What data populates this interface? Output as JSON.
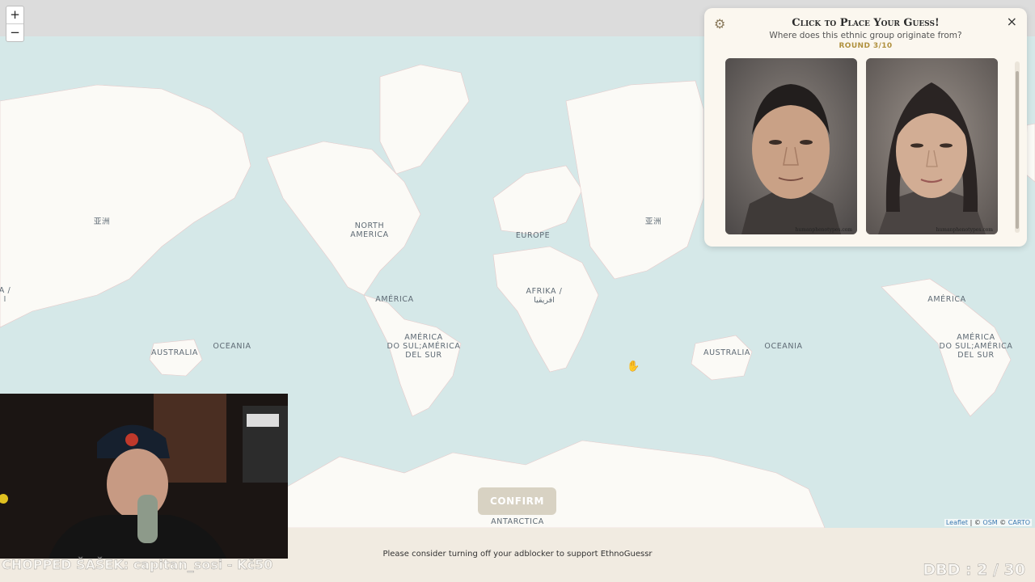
{
  "app": {
    "name": "EthnoGuessr"
  },
  "zoom": {
    "in_label": "+",
    "out_label": "−"
  },
  "panel": {
    "title": "Click to Place Your Guess!",
    "subtitle": "Where does this ethnic group originate from?",
    "round": "ROUND 3/10",
    "photo_credit": "humanphenotypes.com",
    "photos": [
      "male composite face",
      "female composite face"
    ],
    "close_icon": "×",
    "settings_icon": "⚙"
  },
  "map_labels": {
    "asia_l": "亚洲",
    "north_america": "NORTH\nAMERICA",
    "europe": "EUROPE",
    "asia_r": "亚洲",
    "africa": "AFRIKA /\nافريقيا",
    "america_c": "AMÉRICA",
    "south_america_c": "AMÉRICA\nDO SUL;AMÉRICA\nDEL SUR",
    "australia_l": "AUSTRALIA",
    "oceania_l": "OCEANIA",
    "australia_r": "AUSTRALIA",
    "oceania_r": "OCEANIA",
    "america_r": "AMÉRICA",
    "south_america_r": "AMÉRICA\nDO SUL;AMÉRICA\nDEL SUR",
    "antarctica": "ANTARCTICA",
    "edge_left": "A /\nا"
  },
  "confirm_label": "CONFIRM",
  "attribution": {
    "leaflet": "Leaflet",
    "sep1": " | © ",
    "osm": "OSM",
    "sep2": " © ",
    "carto": "CARTO"
  },
  "notice": "Please consider turning off your adblocker to support EthnoGuessr",
  "overlay": {
    "donation": "CHOPPED ŠAŠEK: capitan_sosi - Kč50",
    "counter": "DBD : 2 / 30"
  },
  "colors": {
    "water": "#d5e8e8",
    "land": "#fbfaf6",
    "accent": "#b0913e"
  }
}
